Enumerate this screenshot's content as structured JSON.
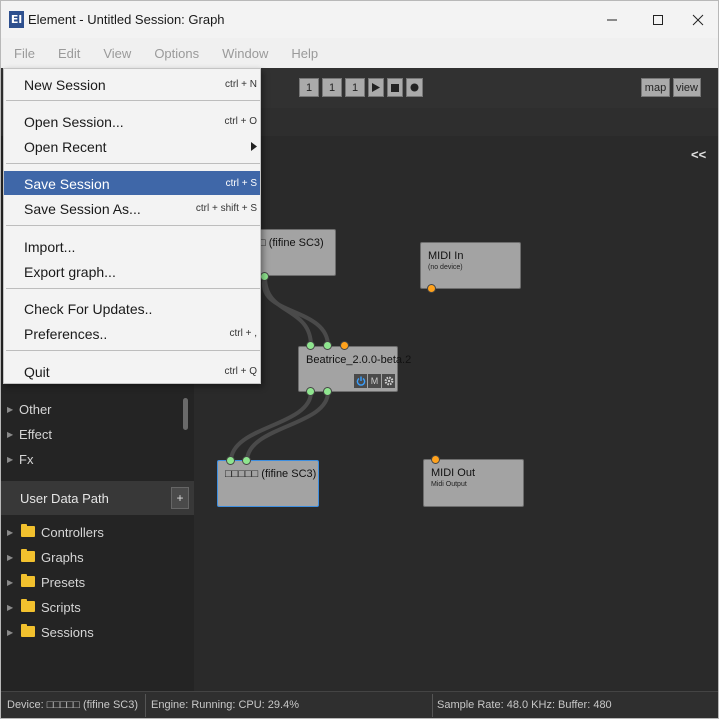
{
  "window": {
    "app_icon_text": "El",
    "title": "Element - Untitled Session: Graph",
    "minimize_icon": "minimize-icon",
    "maximize_icon": "maximize-icon",
    "close_icon": "close-icon"
  },
  "menubar": [
    "File",
    "Edit",
    "View",
    "Options",
    "Window",
    "Help"
  ],
  "toolbar": {
    "bar_values": [
      "1",
      "1",
      "1"
    ],
    "play_icon": "play-icon",
    "stop_icon": "stop-icon",
    "record_icon": "record-icon",
    "map_label": "map",
    "view_label": "view"
  },
  "file_menu": {
    "items": [
      {
        "label": "New Session",
        "shortcut": "ctrl + N"
      },
      {
        "label": "Open Session...",
        "shortcut": "ctrl + O"
      },
      {
        "label": "Open Recent",
        "submenu_icon": "chevron-right-icon"
      },
      {
        "label": "Save Session",
        "shortcut": "ctrl + S",
        "highlighted": true
      },
      {
        "label": "Save Session As...",
        "shortcut": "ctrl + shift + S"
      },
      {
        "label": "Import...",
        "shortcut": ""
      },
      {
        "label": "Export graph...",
        "shortcut": ""
      },
      {
        "label": "Check For Updates..",
        "shortcut": ""
      },
      {
        "label": "Preferences..",
        "shortcut": "ctrl + ,"
      },
      {
        "label": "Quit",
        "shortcut": "ctrl + Q"
      }
    ]
  },
  "left_panel": {
    "plugin_categories": [
      "Other",
      "Effect",
      "Fx"
    ],
    "user_data_path": {
      "title": "User Data Path",
      "add_label": "+",
      "folders": [
        "Controllers",
        "Graphs",
        "Presets",
        "Scripts",
        "Sessions"
      ]
    }
  },
  "graph": {
    "collapse_label": "<<",
    "nodes": {
      "audio_in": {
        "title": "□ (fifine SC3)"
      },
      "midi_in": {
        "title": "MIDI In",
        "subtitle": "(no device)"
      },
      "plugin": {
        "title": "Beatrice_2.0.0-beta.2",
        "mute_label": "M",
        "power_icon": "power-icon",
        "settings_icon": "gear-icon"
      },
      "audio_out": {
        "title": "□□□□□ (fifine SC3)"
      },
      "midi_out": {
        "title": "MIDI Out",
        "subtitle": "Midi Output"
      }
    },
    "colors": {
      "audio_port": "#8fe58f",
      "midi_port": "#ffa21d",
      "selected_border": "#3d8ee0",
      "highlight": "#3f67a8"
    }
  },
  "statusbar": {
    "device": "Device: □□□□□ (fifine SC3)",
    "engine": "Engine: Running:  CPU: 29.4%",
    "sample_rate": "Sample Rate: 48.0 KHz:  Buffer: 480"
  }
}
